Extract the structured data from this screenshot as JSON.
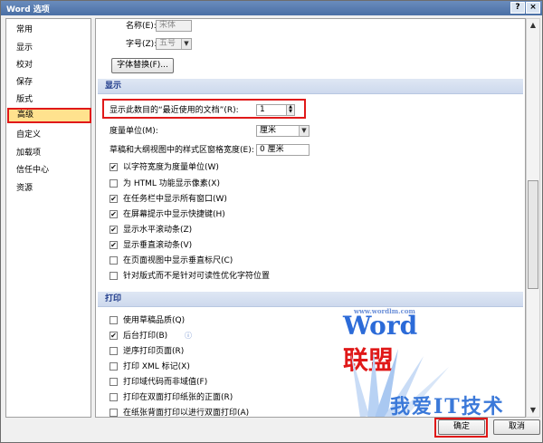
{
  "window": {
    "title": "Word 选项",
    "help_label": "?",
    "close_label": "×"
  },
  "sidebar": {
    "items": [
      {
        "label": "常用"
      },
      {
        "label": "显示"
      },
      {
        "label": "校对"
      },
      {
        "label": "保存"
      },
      {
        "label": "版式"
      },
      {
        "label": "高级",
        "selected": true
      },
      {
        "label": "自定义"
      },
      {
        "label": "加载项"
      },
      {
        "label": "信任中心"
      },
      {
        "label": "资源"
      }
    ]
  },
  "top": {
    "name_label": "名称(E):",
    "name_value": "宋体",
    "size_label": "字号(Z):",
    "size_value": "五号",
    "font_sub_button": "字体替换(F)..."
  },
  "display": {
    "title": "显示",
    "recent_docs_label": "显示此数目的“最近使用的文档”(R):",
    "recent_docs_value": "1",
    "unit_label": "度量单位(M):",
    "unit_value": "厘米",
    "style_width_label": "草稿和大纲视图中的样式区窗格宽度(E):",
    "style_width_value": "0 厘米",
    "checkboxes": [
      {
        "label": "以字符宽度为度量单位(W)",
        "checked": true
      },
      {
        "label": "为 HTML 功能显示像素(X)",
        "checked": false
      },
      {
        "label": "在任务栏中显示所有窗口(W)",
        "checked": true
      },
      {
        "label": "在屏幕提示中显示快捷键(H)",
        "checked": true
      },
      {
        "label": "显示水平滚动条(Z)",
        "checked": true
      },
      {
        "label": "显示垂直滚动条(V)",
        "checked": true
      },
      {
        "label": "在页面视图中显示垂直标尺(C)",
        "checked": false
      },
      {
        "label": "针对版式而不是针对可读性优化字符位置",
        "checked": false
      }
    ]
  },
  "print": {
    "title": "打印",
    "checkboxes": [
      {
        "label": "使用草稿品质(Q)",
        "checked": false
      },
      {
        "label": "后台打印(B)",
        "checked": true
      },
      {
        "label": "逆序打印页面(R)",
        "checked": false
      },
      {
        "label": "打印 XML 标记(X)",
        "checked": false
      },
      {
        "label": "打印域代码而非域值(F)",
        "checked": false
      },
      {
        "label": "打印在双面打印纸张的正面(R)",
        "checked": false
      },
      {
        "label": "在纸张背面打印以进行双面打印(A)",
        "checked": false
      }
    ]
  },
  "footer": {
    "ok": "确定",
    "cancel": "取消"
  },
  "watermark": {
    "logo_w": "W",
    "logo_ord": "ord",
    "logo_cn": "联盟",
    "url": "www.wordlm.com",
    "bottom": "我爱IT技术网"
  },
  "colors": {
    "highlight": "#e01919",
    "selected_bg": "#ffe28e",
    "section_text": "#1e3a8a"
  }
}
